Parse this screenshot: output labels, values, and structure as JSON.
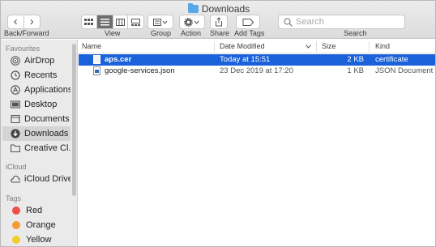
{
  "window": {
    "title": "Downloads"
  },
  "toolbar": {
    "back_label": "Back/Forward",
    "view_label": "View",
    "group_label": "Group",
    "action_label": "Action",
    "share_label": "Share",
    "add_tags_label": "Add Tags",
    "search_label": "Search",
    "search_placeholder": "Search",
    "back_glyph": "‹",
    "forward_glyph": "›"
  },
  "sidebar": {
    "favourites_title": "Favourites",
    "favourites": [
      {
        "label": "AirDrop",
        "icon": "airdrop-icon"
      },
      {
        "label": "Recents",
        "icon": "clock-icon"
      },
      {
        "label": "Applications",
        "icon": "applications-icon"
      },
      {
        "label": "Desktop",
        "icon": "desktop-icon"
      },
      {
        "label": "Documents",
        "icon": "document-icon"
      },
      {
        "label": "Downloads",
        "icon": "download-icon"
      },
      {
        "label": "Creative Cl...",
        "icon": "folder-icon"
      }
    ],
    "icloud_title": "iCloud",
    "icloud": [
      {
        "label": "iCloud Drive",
        "icon": "cloud-icon"
      }
    ],
    "tags_title": "Tags",
    "tags": [
      {
        "label": "Red",
        "color": "#f0504a"
      },
      {
        "label": "Orange",
        "color": "#f59a32"
      },
      {
        "label": "Yellow",
        "color": "#f2cd2a"
      }
    ]
  },
  "list": {
    "columns": {
      "name": "Name",
      "date": "Date Modified",
      "size": "Size",
      "kind": "Kind"
    },
    "rows": [
      {
        "name": "aps.cer",
        "date": "Today at 15:51",
        "size": "2 KB",
        "kind": "certificate"
      },
      {
        "name": "google-services.json",
        "date": "23 Dec 2019 at 17:20",
        "size": "1 KB",
        "kind": "JSON Document"
      }
    ]
  },
  "colors": {
    "selection": "#1a62d9",
    "folder_blue": "#56a8e8"
  }
}
